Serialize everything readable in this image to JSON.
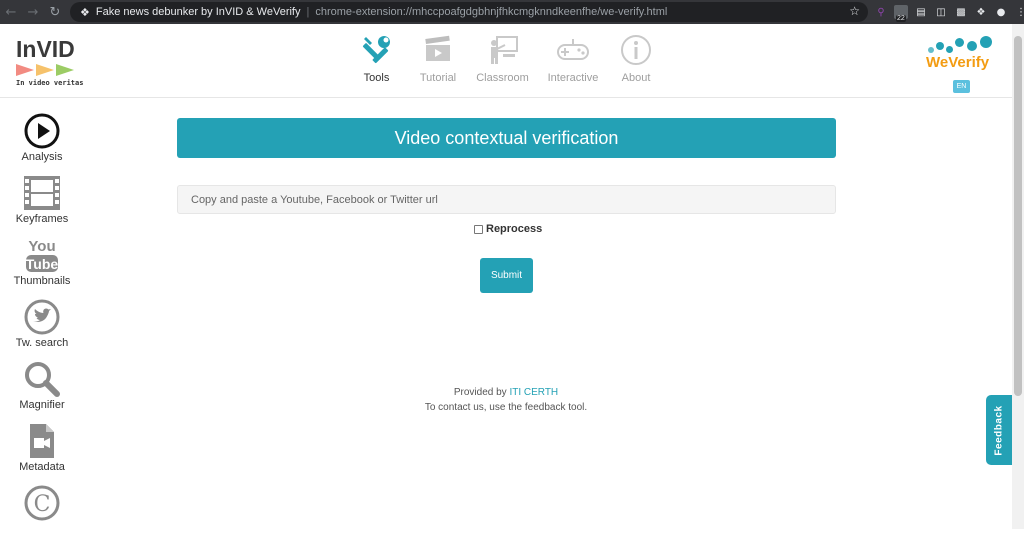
{
  "browser": {
    "tab_title": "Fake news debunker by InVID & WeVerify",
    "url": "chrome-extension://mhccpoafgdgbhnjfhkcmgknndkeenfhe/we-verify.html",
    "ext_badge": "22"
  },
  "brand": {
    "left_logo_text": "InVID",
    "left_tagline": "In video veritas",
    "right_logo_text": "WeVerify",
    "language": "EN"
  },
  "topnav": [
    {
      "label": "Tools",
      "icon": "tools-icon",
      "active": true
    },
    {
      "label": "Tutorial",
      "icon": "clapperboard-icon",
      "active": false
    },
    {
      "label": "Classroom",
      "icon": "classroom-icon",
      "active": false
    },
    {
      "label": "Interactive",
      "icon": "gamepad-icon",
      "active": false
    },
    {
      "label": "About",
      "icon": "info-icon",
      "active": false
    }
  ],
  "sidebar": [
    {
      "label": "Analysis",
      "icon": "play-circle-icon"
    },
    {
      "label": "Keyframes",
      "icon": "film-strip-icon"
    },
    {
      "label": "Thumbnails",
      "icon": "youtube-icon"
    },
    {
      "label": "Tw. search",
      "icon": "twitter-icon"
    },
    {
      "label": "Magnifier",
      "icon": "magnifier-icon"
    },
    {
      "label": "Metadata",
      "icon": "file-video-icon"
    },
    {
      "label": "",
      "icon": "copyright-icon"
    }
  ],
  "main": {
    "title": "Video contextual verification",
    "input_placeholder": "Copy and paste a Youtube, Facebook or Twitter url",
    "reprocess_label": "Reprocess",
    "submit_label": "Submit"
  },
  "footer": {
    "provided_by": "Provided by",
    "provider": "ITI CERTH",
    "contact": "To contact us, use the feedback tool."
  },
  "feedback_label": "Feedback",
  "colors": {
    "accent": "#24a1b5",
    "brand_orange": "#f39c12"
  }
}
